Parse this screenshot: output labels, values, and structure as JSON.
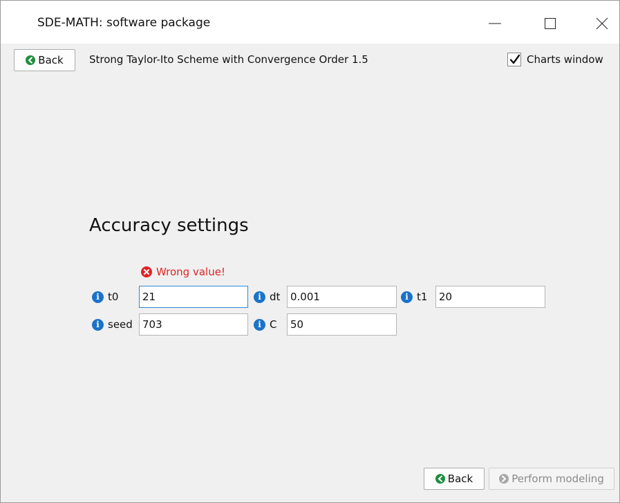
{
  "window": {
    "title": "SDE-MATH: software package"
  },
  "toolbar": {
    "back_label": "Back",
    "scheme_title": "Strong Taylor-Ito Scheme with Convergence Order 1.5",
    "charts_window_label": "Charts window",
    "charts_window_checked": true
  },
  "settings": {
    "heading": "Accuracy settings",
    "error_message": "Wrong value!",
    "fields": {
      "t0": {
        "label": "t0",
        "value": "21"
      },
      "dt": {
        "label": "dt",
        "value": "0.001"
      },
      "t1": {
        "label": "t1",
        "value": "20"
      },
      "seed": {
        "label": "seed",
        "value": "703"
      },
      "c": {
        "label": "C",
        "value": "50"
      }
    }
  },
  "footer": {
    "back_label": "Back",
    "perform_label": "Perform modeling"
  },
  "colors": {
    "accent_blue": "#1a73c7",
    "back_icon_green": "#1e8e3e",
    "error_red": "#e02424",
    "focus_border": "#2b88d8"
  },
  "icons": {
    "back": "back-arrow-icon",
    "info": "info-icon",
    "error": "error-icon",
    "perform": "forward-arrow-icon"
  }
}
